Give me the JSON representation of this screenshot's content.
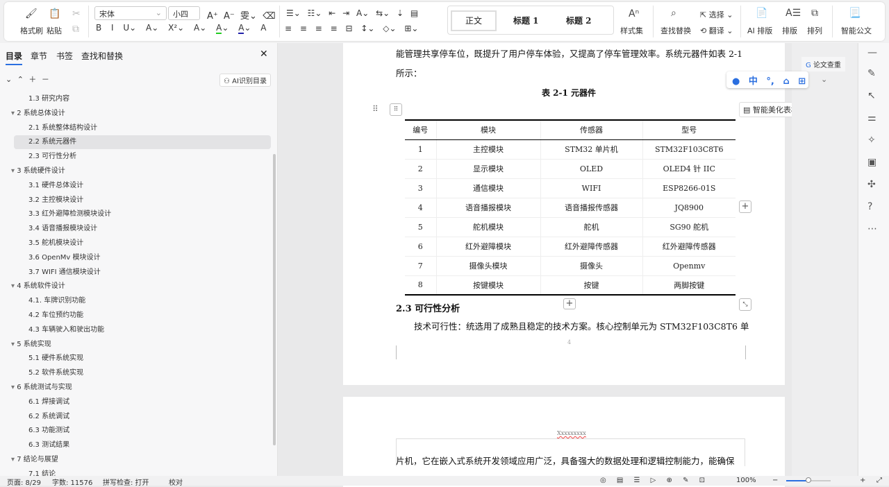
{
  "toolbar": {
    "format_painter": "格式刷",
    "paste": "粘贴",
    "font": "宋体",
    "size": "小四",
    "styles": [
      "正文",
      "标题 1",
      "标题 2"
    ],
    "style_set": "样式集",
    "find_replace": "查找替换",
    "select": "选择",
    "translate": "翻译",
    "ai_layout": "AI 排版",
    "layout": "排版",
    "arrange": "排列",
    "smart_doc": "智能公文"
  },
  "sidebar": {
    "tabs": [
      "目录",
      "章节",
      "书签",
      "查找和替换"
    ],
    "ai_toc": "AI识别目录",
    "items": [
      {
        "label": "1.3 研究内容",
        "level": 2
      },
      {
        "label": "2 系统总体设计",
        "level": 1
      },
      {
        "label": "2.1 系统整体结构设计",
        "level": 2
      },
      {
        "label": "2.2 系统元器件",
        "level": 2,
        "active": true
      },
      {
        "label": "2.3 可行性分析",
        "level": 2
      },
      {
        "label": "3 系统硬件设计",
        "level": 1
      },
      {
        "label": "3.1 硬件总体设计",
        "level": 2
      },
      {
        "label": "3.2 主控模块设计",
        "level": 2
      },
      {
        "label": "3.3 红外避障检测模块设计",
        "level": 2
      },
      {
        "label": "3.4 语音播报模块设计",
        "level": 2
      },
      {
        "label": "3.5 舵机模块设计",
        "level": 2
      },
      {
        "label": "3.6 OpenMv 模块设计",
        "level": 2
      },
      {
        "label": "3.7 WIFI 通信模块设计",
        "level": 2
      },
      {
        "label": "4 系统软件设计",
        "level": 1
      },
      {
        "label": "4.1. 车牌识别功能",
        "level": 2
      },
      {
        "label": "4.2 车位预约功能",
        "level": 2
      },
      {
        "label": "4.3 车辆驶入和驶出功能",
        "level": 2
      },
      {
        "label": "5 系统实现",
        "level": 1
      },
      {
        "label": "5.1 硬件系统实现",
        "level": 2
      },
      {
        "label": "5.2 软件系统实现",
        "level": 2
      },
      {
        "label": "6 系统测试与实现",
        "level": 1
      },
      {
        "label": "6.1 焊接调试",
        "level": 2
      },
      {
        "label": "6.2 系统调试",
        "level": 2
      },
      {
        "label": "6.3 功能测试",
        "level": 2
      },
      {
        "label": "6.3 测试结果",
        "level": 2
      },
      {
        "label": "7 结论与展望",
        "level": 1
      },
      {
        "label": "7.1 结论",
        "level": 2
      }
    ]
  },
  "doc": {
    "para1": "能管理共享停车位，既提升了用户停车体验，又提高了停车管理效率。系统元器件如表 2-1",
    "para2": "所示：",
    "table_caption": "表 2-1  元器件",
    "beautify": "智能美化表格",
    "table": {
      "headers": [
        "编号",
        "模块",
        "传感器",
        "型号"
      ],
      "rows": [
        [
          "1",
          "主控模块",
          "STM32 单片机",
          "STM32F103C8T6"
        ],
        [
          "2",
          "显示模块",
          "OLED",
          "OLED4 针 IIC"
        ],
        [
          "3",
          "通信模块",
          "WIFI",
          "ESP8266-01S"
        ],
        [
          "4",
          "语音播报模块",
          "语音播报传感器",
          "JQ8900"
        ],
        [
          "5",
          "舵机模块",
          "舵机",
          "SG90 舵机"
        ],
        [
          "6",
          "红外避障模块",
          "红外避障传感器",
          "红外避障传感器"
        ],
        [
          "7",
          "摄像头模块",
          "摄像头",
          "Openmv"
        ],
        [
          "8",
          "按键模块",
          "按键",
          "两脚按键"
        ]
      ]
    },
    "heading": "2.3  可行性分析",
    "para3": "技术可行性：统选用了成熟且稳定的技术方案。核心控制单元为 STM32F103C8T6 单",
    "page_num": "4",
    "header2": "Xxxxxxxxx",
    "para4": "片机，它在嵌入式系统开发领域应用广泛，具备强大的数据处理和逻辑控制能力，能确保"
  },
  "right": {
    "plagiarism": "论文查重",
    "ime": "中"
  },
  "status": {
    "page": "页面: 8/29",
    "words": "字数: 11576",
    "spell": "拼写检查: 打开",
    "proof": "校对",
    "zoom": "100%",
    "zoom_fraction": 0.5
  }
}
